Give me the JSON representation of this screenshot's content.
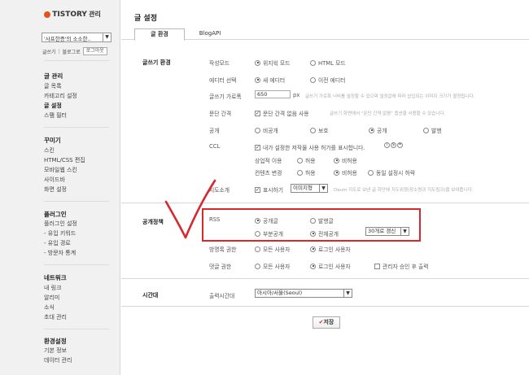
{
  "sidebar": {
    "logo_text": "TISTORY",
    "logo_suffix": "관리",
    "blog_select_value": "'사프한증'의 소소한..",
    "top_links": [
      "글쓰기",
      "블로그로",
      "로그아웃"
    ],
    "sections": [
      {
        "title": "글 관리",
        "items": [
          "글 목록",
          "카테고리 설정",
          "글 설정",
          "스팸 필터"
        ],
        "active": "글 설정"
      },
      {
        "title": "꾸미기",
        "items": [
          "스킨",
          "HTML/CSS 편집",
          "모바일웹 스킨",
          "사이드바",
          "화면 설정"
        ]
      },
      {
        "title": "플러그인",
        "items": [
          "플러그인 설정",
          "- 유입 키워드",
          "- 유입 경로",
          "- 방문자 통계"
        ]
      },
      {
        "title": "네트워크",
        "items": [
          "내 링크",
          "알리미",
          "소식",
          "초대 관리"
        ]
      },
      {
        "title": "환경설정",
        "items": [
          "기본 정보",
          "데이터 관리"
        ]
      }
    ]
  },
  "main": {
    "page_title": "글 설정",
    "tabs": [
      "글 환경",
      "BlogAPI"
    ],
    "writing": {
      "section_label": "글쓰기 환경",
      "mode_label": "작성모드",
      "mode_options": [
        "위지윅 모드",
        "HTML 모드"
      ],
      "editor_label": "에디터 선택",
      "editor_options": [
        "새 에디터",
        "이전 에디터"
      ],
      "width_label": "글쓰기 가로폭",
      "width_value": "650",
      "width_unit": "px",
      "width_help": "글쓰기 가로폭 너비를 설정할 수 있으며 설정값에 따라 삽입되는 이미지 크기가 결정됩니다.",
      "para_label": "문단 간격",
      "para_check": "문단 간격 없음 사용",
      "para_help": "글쓰기 화면에서 \"문단 간격 없음\" 옵션을 사용할 수 있습니다.",
      "public_label": "공개",
      "public_options": [
        "비공개",
        "보호",
        "공개",
        "발행"
      ],
      "ccl_label": "CCL",
      "ccl_check": "내가 설정한 저작물 사용 허가를 표시합니다.",
      "commercial_label": "상업적 이용",
      "commercial_options": [
        "허용",
        "비허용"
      ],
      "change_label": "컨텐츠 변경",
      "change_options": [
        "허용",
        "비허용",
        "동일 설정시 허락"
      ],
      "map_label": "지도소개",
      "map_check": "표시하기",
      "map_select": "이미지형",
      "map_help": "Daum 지도로 보낸 글 하단에 지도위젯(장소명과 지도링크)을 보여줍니다."
    },
    "publish": {
      "section_label": "공개정책",
      "rss_label": "RSS",
      "rss_row1": [
        "공개글",
        "발행글"
      ],
      "rss_row2": [
        "부분공개",
        "전체공개"
      ],
      "rss_select": "30개로 갱신",
      "trackback_label": "방명록 권한",
      "trackback_options": [
        "모든 사용자",
        "로그인 사용자"
      ],
      "comment_label": "댓글 권한",
      "comment_options": [
        "모든 사용자",
        "로그인 사용자",
        "관리자 승인 후 출력"
      ]
    },
    "timezone": {
      "section_label": "시간대",
      "label": "출력시간대",
      "value": "아시아/서울(Seoul)"
    },
    "save_label": "저장"
  },
  "colors": {
    "highlight_box": "#d7282e",
    "checkmark": "#d7282e",
    "logo": "#e2541c"
  }
}
